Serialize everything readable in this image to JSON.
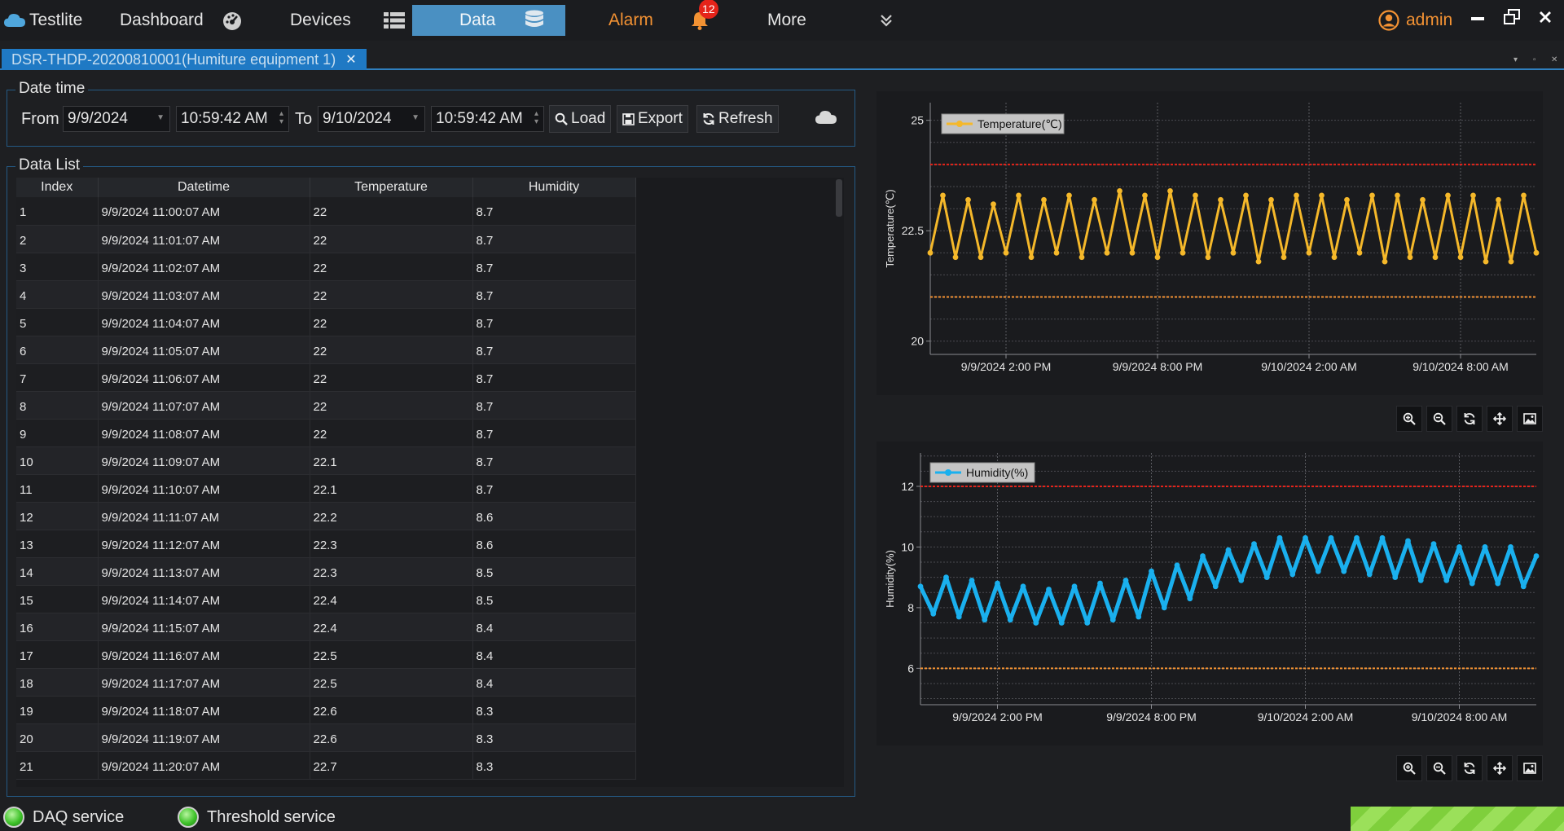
{
  "nav": {
    "brand": "Testlite",
    "dashboard": "Dashboard",
    "devices": "Devices",
    "data": "Data",
    "alarm": "Alarm",
    "alarm_count": "12",
    "more": "More",
    "user": "admin"
  },
  "tab": {
    "title": "DSR-THDP-20200810001(Humiture equipment 1)"
  },
  "datetime": {
    "group_title": "Date time",
    "from_label": "From",
    "from_date": "9/9/2024",
    "from_time": "10:59:42 AM",
    "to_label": "To",
    "to_date": "9/10/2024",
    "to_time": "10:59:42 AM",
    "load": "Load",
    "export": "Export",
    "refresh": "Refresh"
  },
  "datalist": {
    "group_title": "Data List",
    "columns": [
      "Index",
      "Datetime",
      "Temperature",
      "Humidity"
    ],
    "rows": [
      [
        "1",
        "9/9/2024 11:00:07 AM",
        "22",
        "8.7"
      ],
      [
        "2",
        "9/9/2024 11:01:07 AM",
        "22",
        "8.7"
      ],
      [
        "3",
        "9/9/2024 11:02:07 AM",
        "22",
        "8.7"
      ],
      [
        "4",
        "9/9/2024 11:03:07 AM",
        "22",
        "8.7"
      ],
      [
        "5",
        "9/9/2024 11:04:07 AM",
        "22",
        "8.7"
      ],
      [
        "6",
        "9/9/2024 11:05:07 AM",
        "22",
        "8.7"
      ],
      [
        "7",
        "9/9/2024 11:06:07 AM",
        "22",
        "8.7"
      ],
      [
        "8",
        "9/9/2024 11:07:07 AM",
        "22",
        "8.7"
      ],
      [
        "9",
        "9/9/2024 11:08:07 AM",
        "22",
        "8.7"
      ],
      [
        "10",
        "9/9/2024 11:09:07 AM",
        "22.1",
        "8.7"
      ],
      [
        "11",
        "9/9/2024 11:10:07 AM",
        "22.1",
        "8.7"
      ],
      [
        "12",
        "9/9/2024 11:11:07 AM",
        "22.2",
        "8.6"
      ],
      [
        "13",
        "9/9/2024 11:12:07 AM",
        "22.3",
        "8.6"
      ],
      [
        "14",
        "9/9/2024 11:13:07 AM",
        "22.3",
        "8.5"
      ],
      [
        "15",
        "9/9/2024 11:14:07 AM",
        "22.4",
        "8.5"
      ],
      [
        "16",
        "9/9/2024 11:15:07 AM",
        "22.4",
        "8.4"
      ],
      [
        "17",
        "9/9/2024 11:16:07 AM",
        "22.5",
        "8.4"
      ],
      [
        "18",
        "9/9/2024 11:17:07 AM",
        "22.5",
        "8.4"
      ],
      [
        "19",
        "9/9/2024 11:18:07 AM",
        "22.6",
        "8.3"
      ],
      [
        "20",
        "9/9/2024 11:19:07 AM",
        "22.6",
        "8.3"
      ],
      [
        "21",
        "9/9/2024 11:20:07 AM",
        "22.7",
        "8.3"
      ]
    ]
  },
  "status": {
    "daq": "DAQ service",
    "threshold": "Threshold service"
  },
  "colors": {
    "temperature": "#f5b82a",
    "humidity": "#1ab0ee",
    "upper_threshold": "#e5231a",
    "lower_threshold": "#f39233",
    "accent": "#1f79c4"
  },
  "chart_data": [
    {
      "type": "line",
      "legend": "Temperature(℃)",
      "ylabel": "Temperature(℃)",
      "ylim": [
        19.7,
        25.4
      ],
      "yticks": [
        20,
        22.5,
        25
      ],
      "xticks": [
        "9/9/2024 2:00 PM",
        "9/9/2024 8:00 PM",
        "9/10/2024 2:00 AM",
        "9/10/2024 8:00 AM"
      ],
      "xtick_hours": [
        3,
        9,
        15,
        21
      ],
      "x_range_hours": [
        0,
        24
      ],
      "grid": true,
      "legend_position": "top-left",
      "thresholds": {
        "upper": 24,
        "lower": 21
      },
      "series": [
        {
          "name": "Temperature(℃)",
          "x_hours": [
            0,
            0.5,
            1.0,
            1.5,
            2.0,
            2.5,
            3.0,
            3.5,
            4.0,
            4.5,
            5.0,
            5.5,
            6.0,
            6.5,
            7.0,
            7.5,
            8.0,
            8.5,
            9.0,
            9.5,
            10.0,
            10.5,
            11.0,
            11.5,
            12.0,
            12.5,
            13.0,
            13.5,
            14.0,
            14.5,
            15.0,
            15.5,
            16.0,
            16.5,
            17.0,
            17.5,
            18.0,
            18.5,
            19.0,
            19.5,
            20.0,
            20.5,
            21.0,
            21.5,
            22.0,
            22.5,
            23.0,
            23.5,
            24.0
          ],
          "values": [
            22.0,
            23.3,
            21.9,
            23.2,
            21.9,
            23.1,
            22.0,
            23.3,
            21.9,
            23.2,
            22.0,
            23.3,
            21.9,
            23.2,
            22.0,
            23.4,
            22.0,
            23.3,
            21.9,
            23.4,
            22.0,
            23.3,
            21.9,
            23.2,
            22.0,
            23.3,
            21.8,
            23.2,
            21.9,
            23.3,
            22.0,
            23.3,
            21.9,
            23.2,
            22.0,
            23.3,
            21.8,
            23.3,
            21.9,
            23.2,
            21.9,
            23.3,
            21.9,
            23.3,
            21.8,
            23.2,
            21.8,
            23.3,
            22.0
          ]
        }
      ]
    },
    {
      "type": "line",
      "legend": "Humidity(%)",
      "ylabel": "Humidity(%)",
      "ylim": [
        4.8,
        13.1
      ],
      "yticks": [
        6,
        8,
        10,
        12
      ],
      "xticks": [
        "9/9/2024 2:00 PM",
        "9/9/2024 8:00 PM",
        "9/10/2024 2:00 AM",
        "9/10/2024 8:00 AM"
      ],
      "xtick_hours": [
        3,
        9,
        15,
        21
      ],
      "x_range_hours": [
        0,
        24
      ],
      "grid": true,
      "legend_position": "top-left",
      "thresholds": {
        "upper": 12,
        "lower": 6
      },
      "series": [
        {
          "name": "Humidity(%)",
          "x_hours": [
            0,
            0.5,
            1.0,
            1.5,
            2.0,
            2.5,
            3.0,
            3.5,
            4.0,
            4.5,
            5.0,
            5.5,
            6.0,
            6.5,
            7.0,
            7.5,
            8.0,
            8.5,
            9.0,
            9.5,
            10.0,
            10.5,
            11.0,
            11.5,
            12.0,
            12.5,
            13.0,
            13.5,
            14.0,
            14.5,
            15.0,
            15.5,
            16.0,
            16.5,
            17.0,
            17.5,
            18.0,
            18.5,
            19.0,
            19.5,
            20.0,
            20.5,
            21.0,
            21.5,
            22.0,
            22.5,
            23.0,
            23.5,
            24.0
          ],
          "values": [
            8.7,
            7.8,
            9.0,
            7.7,
            8.9,
            7.6,
            8.8,
            7.6,
            8.7,
            7.5,
            8.6,
            7.5,
            8.7,
            7.5,
            8.8,
            7.6,
            8.9,
            7.7,
            9.2,
            8.0,
            9.4,
            8.3,
            9.7,
            8.7,
            9.9,
            8.9,
            10.1,
            9.0,
            10.3,
            9.1,
            10.3,
            9.2,
            10.3,
            9.2,
            10.3,
            9.1,
            10.3,
            9.0,
            10.2,
            8.9,
            10.1,
            8.9,
            10.0,
            8.8,
            10.0,
            8.8,
            10.0,
            8.7,
            9.7
          ]
        }
      ]
    }
  ]
}
